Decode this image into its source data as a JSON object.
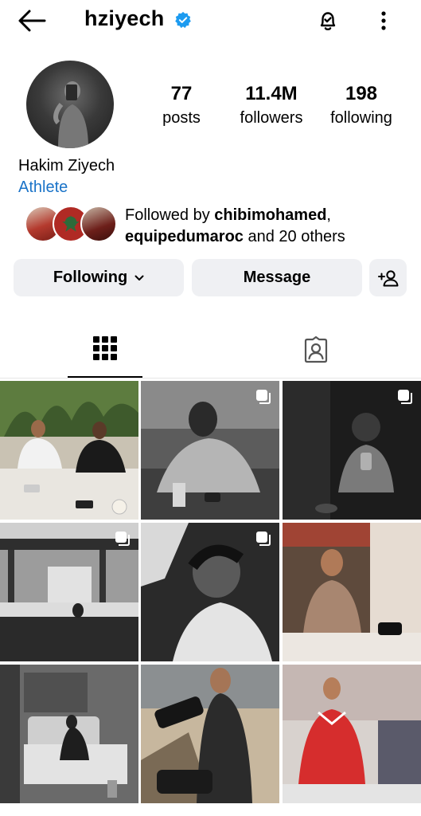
{
  "header": {
    "username": "hziyech"
  },
  "profile": {
    "stats": [
      {
        "value": "77",
        "label": "posts"
      },
      {
        "value": "11.4M",
        "label": "followers"
      },
      {
        "value": "198",
        "label": "following"
      }
    ],
    "full_name": "Hakim Ziyech",
    "category": "Athlete",
    "followed_by": {
      "prefix": "Followed by ",
      "user1": "chibimohamed",
      "sep": ",",
      "user2": "equipedumaroc",
      "suffix": " and 20 others"
    }
  },
  "actions": {
    "following_label": "Following",
    "message_label": "Message"
  },
  "colors": {
    "verified": "#1d9bf0",
    "link": "#1a73c8",
    "button_bg": "#eff0f3"
  },
  "icons": [
    "back-arrow-icon",
    "verified-badge-icon",
    "notification-bell-icon",
    "more-options-icon",
    "chevron-down-icon",
    "add-user-icon",
    "grid-icon",
    "tagged-icon",
    "multiple-posts-icon"
  ]
}
